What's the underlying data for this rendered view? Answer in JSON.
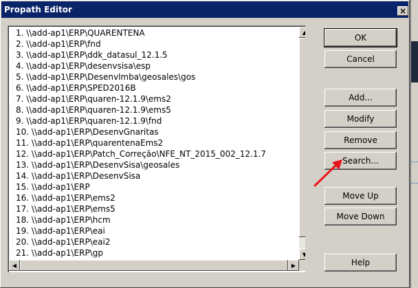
{
  "window": {
    "title": "Propath Editor",
    "close_symbol": "×"
  },
  "list": {
    "items": [
      "1. \\\\add-ap1\\ERP\\QUARENTENA",
      "2. \\\\add-ap1\\ERP\\fnd",
      "3. \\\\add-ap1\\ERP\\ddk_datasul_12.1.5",
      "4. \\\\add-ap1\\ERP\\desenvsisa\\esp",
      "5. \\\\add-ap1\\ERP\\Desenvlmba\\geosales\\gos",
      "6. \\\\add-ap1\\ERP\\SPED2016B",
      "7. \\\\add-ap1\\ERP\\quaren-12.1.9\\ems2",
      "8. \\\\add-ap1\\ERP\\quaren-12.1.9\\ems5",
      "9. \\\\add-ap1\\ERP\\quaren-12.1.9\\fnd",
      "10. \\\\add-ap1\\ERP\\DesenvGnaritas",
      "11. \\\\add-ap1\\ERP\\quarentenaEms2",
      "12. \\\\add-ap1\\ERP\\Patch_Correção\\NFE_NT_2015_002_12.1.7",
      "13. \\\\add-ap1\\ERP\\DesenvSisa\\geosales",
      "14. \\\\add-ap1\\ERP\\DesenvSisa",
      "15. \\\\add-ap1\\ERP",
      "16. \\\\add-ap1\\ERP\\ems2",
      "17. \\\\add-ap1\\ERP\\ems5",
      "18. \\\\add-ap1\\ERP\\hcm",
      "19. \\\\add-ap1\\ERP\\eai",
      "20. \\\\add-ap1\\ERP\\eai2",
      "21. \\\\add-ap1\\ERP\\gp"
    ]
  },
  "buttons": {
    "ok": "OK",
    "cancel": "Cancel",
    "add": "Add...",
    "modify": "Modify",
    "remove": "Remove",
    "search": "Search...",
    "move_up": "Move Up",
    "move_down": "Move Down",
    "help": "Help"
  },
  "scroll_icons": {
    "up": "▲",
    "down": "▼",
    "left": "◀",
    "right": "▶"
  },
  "colors": {
    "titlebar": "#0a246a",
    "annotation_arrow": "#e8141b"
  }
}
